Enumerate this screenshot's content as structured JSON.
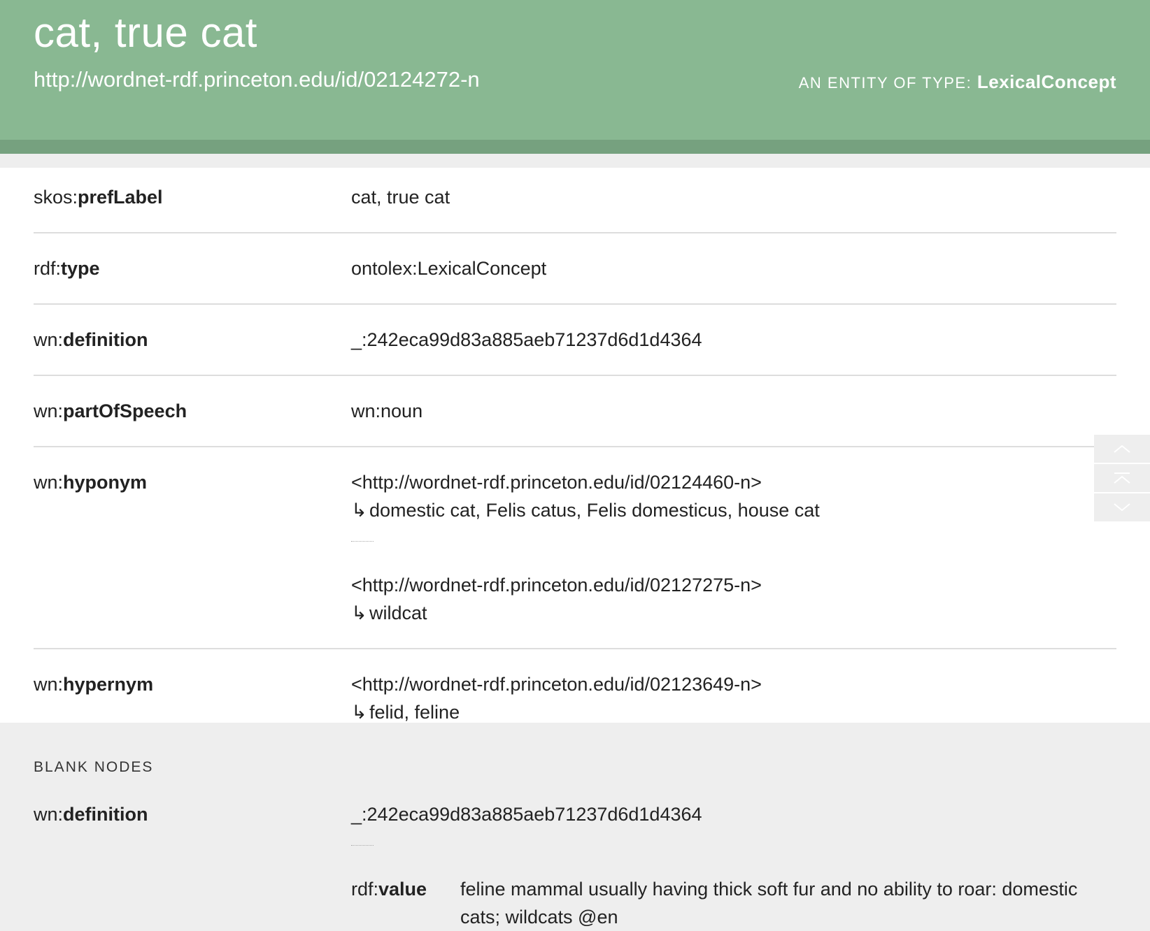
{
  "header": {
    "title": "cat, true cat",
    "uri": "http://wordnet-rdf.princeton.edu/id/02124272-n",
    "entity_type_label": "AN ENTITY OF TYPE: ",
    "entity_type_value": "LexicalConcept"
  },
  "properties": [
    {
      "prefix": "skos:",
      "name": "prefLabel",
      "values": [
        {
          "value": "cat, true cat"
        }
      ]
    },
    {
      "prefix": "rdf:",
      "name": "type",
      "values": [
        {
          "value": "ontolex:LexicalConcept"
        }
      ]
    },
    {
      "prefix": "wn:",
      "name": "definition",
      "values": [
        {
          "value": "_:242eca99d83a885aeb71237d6d1d4364"
        }
      ]
    },
    {
      "prefix": "wn:",
      "name": "partOfSpeech",
      "values": [
        {
          "value": "wn:noun"
        }
      ]
    },
    {
      "prefix": "wn:",
      "name": "hyponym",
      "values": [
        {
          "value": "<http://wordnet-rdf.princeton.edu/id/02124460-n>",
          "label": "domestic cat, Felis catus, Felis domesticus, house cat"
        },
        {
          "value": "<http://wordnet-rdf.princeton.edu/id/02127275-n>",
          "label": "wildcat"
        }
      ]
    },
    {
      "prefix": "wn:",
      "name": "hypernym",
      "values": [
        {
          "value": "<http://wordnet-rdf.princeton.edu/id/02123649-n>",
          "label": "felid, feline"
        }
      ]
    }
  ],
  "blank_nodes": {
    "title": "BLANK NODES",
    "items": [
      {
        "prefix": "wn:",
        "name": "definition",
        "value": "_:242eca99d83a885aeb71237d6d1d4364",
        "nested": {
          "prefix": "rdf:",
          "name": "value",
          "value": "feline mammal usually having thick soft fur and no ability to roar: domestic cats; wildcats  @en"
        }
      }
    ]
  },
  "nav": {
    "icons": [
      "chevron-up-icon",
      "scroll-to-top-icon",
      "chevron-down-icon"
    ]
  },
  "arrow_glyph": "↳"
}
